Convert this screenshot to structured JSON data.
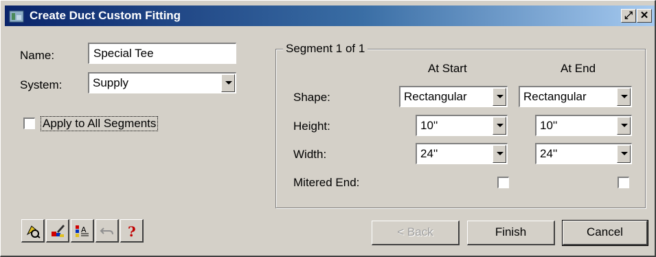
{
  "window": {
    "title": "Create Duct Custom Fitting",
    "pin_glyph": "⤢",
    "close_glyph": "✕"
  },
  "form": {
    "name_label": "Name:",
    "name_value": "Special Tee",
    "system_label": "System:",
    "system_value": "Supply",
    "apply_all_label": "Apply to All Segments",
    "apply_all_checked": false
  },
  "segment": {
    "group_title": "Segment 1 of 1",
    "col_start": "At Start",
    "col_end": "At End",
    "shape_label": "Shape:",
    "shape_start": "Rectangular",
    "shape_end": "Rectangular",
    "height_label": "Height:",
    "height_start": "10''",
    "height_end": "10''",
    "width_label": "Width:",
    "width_start": "24''",
    "width_end": "24''",
    "mitered_label": "Mitered End:",
    "mitered_start_checked": false,
    "mitered_end_checked": false
  },
  "toolbar_icons": [
    "pickup-properties-icon",
    "match-properties-icon",
    "style-manager-icon",
    "undo-icon",
    "help-icon"
  ],
  "buttons": {
    "back": "< Back",
    "finish": "Finish",
    "cancel": "Cancel"
  },
  "colors": {
    "dialog_bg": "#d4d0c8",
    "title_start": "#0a246a",
    "title_end": "#a6caf0",
    "help_red": "#c00000"
  }
}
